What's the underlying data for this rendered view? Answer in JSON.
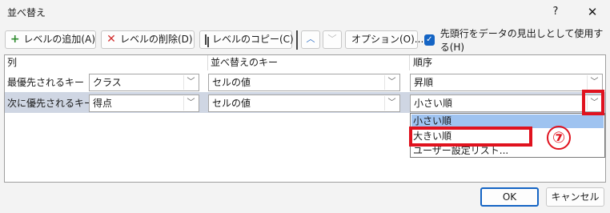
{
  "window": {
    "title": "並べ替え",
    "help": "?",
    "close": "✕"
  },
  "toolbar": {
    "add_level": "レベルの追加(A)",
    "delete_level": "レベルの削除(D)",
    "copy_level": "レベルのコピー(C)",
    "options": "オプション(O)...",
    "header_checkbox_label": "先頭行をデータの見出しとして使用する(H)",
    "header_checkbox_checked": true
  },
  "grid": {
    "headers": [
      "列",
      "並べ替えのキー",
      "順序"
    ],
    "rows": [
      {
        "label": "最優先されるキー",
        "column": "クラス",
        "key": "セルの値",
        "order": "昇順"
      },
      {
        "label": "次に優先されるキー",
        "column": "得点",
        "key": "セルの値",
        "order": "小さい順"
      }
    ]
  },
  "order_dropdown": {
    "options": [
      "小さい順",
      "大きい順",
      "ユーザー設定リスト..."
    ],
    "highlighted_index": 0
  },
  "annotation": {
    "step": "⑦",
    "color": "#e0121e"
  },
  "buttons": {
    "ok": "OK",
    "cancel": "キャンセル"
  },
  "colors": {
    "accent": "#1464c4",
    "selected_row": "#cfd6e3",
    "highlight_option": "#9fc3f0"
  }
}
